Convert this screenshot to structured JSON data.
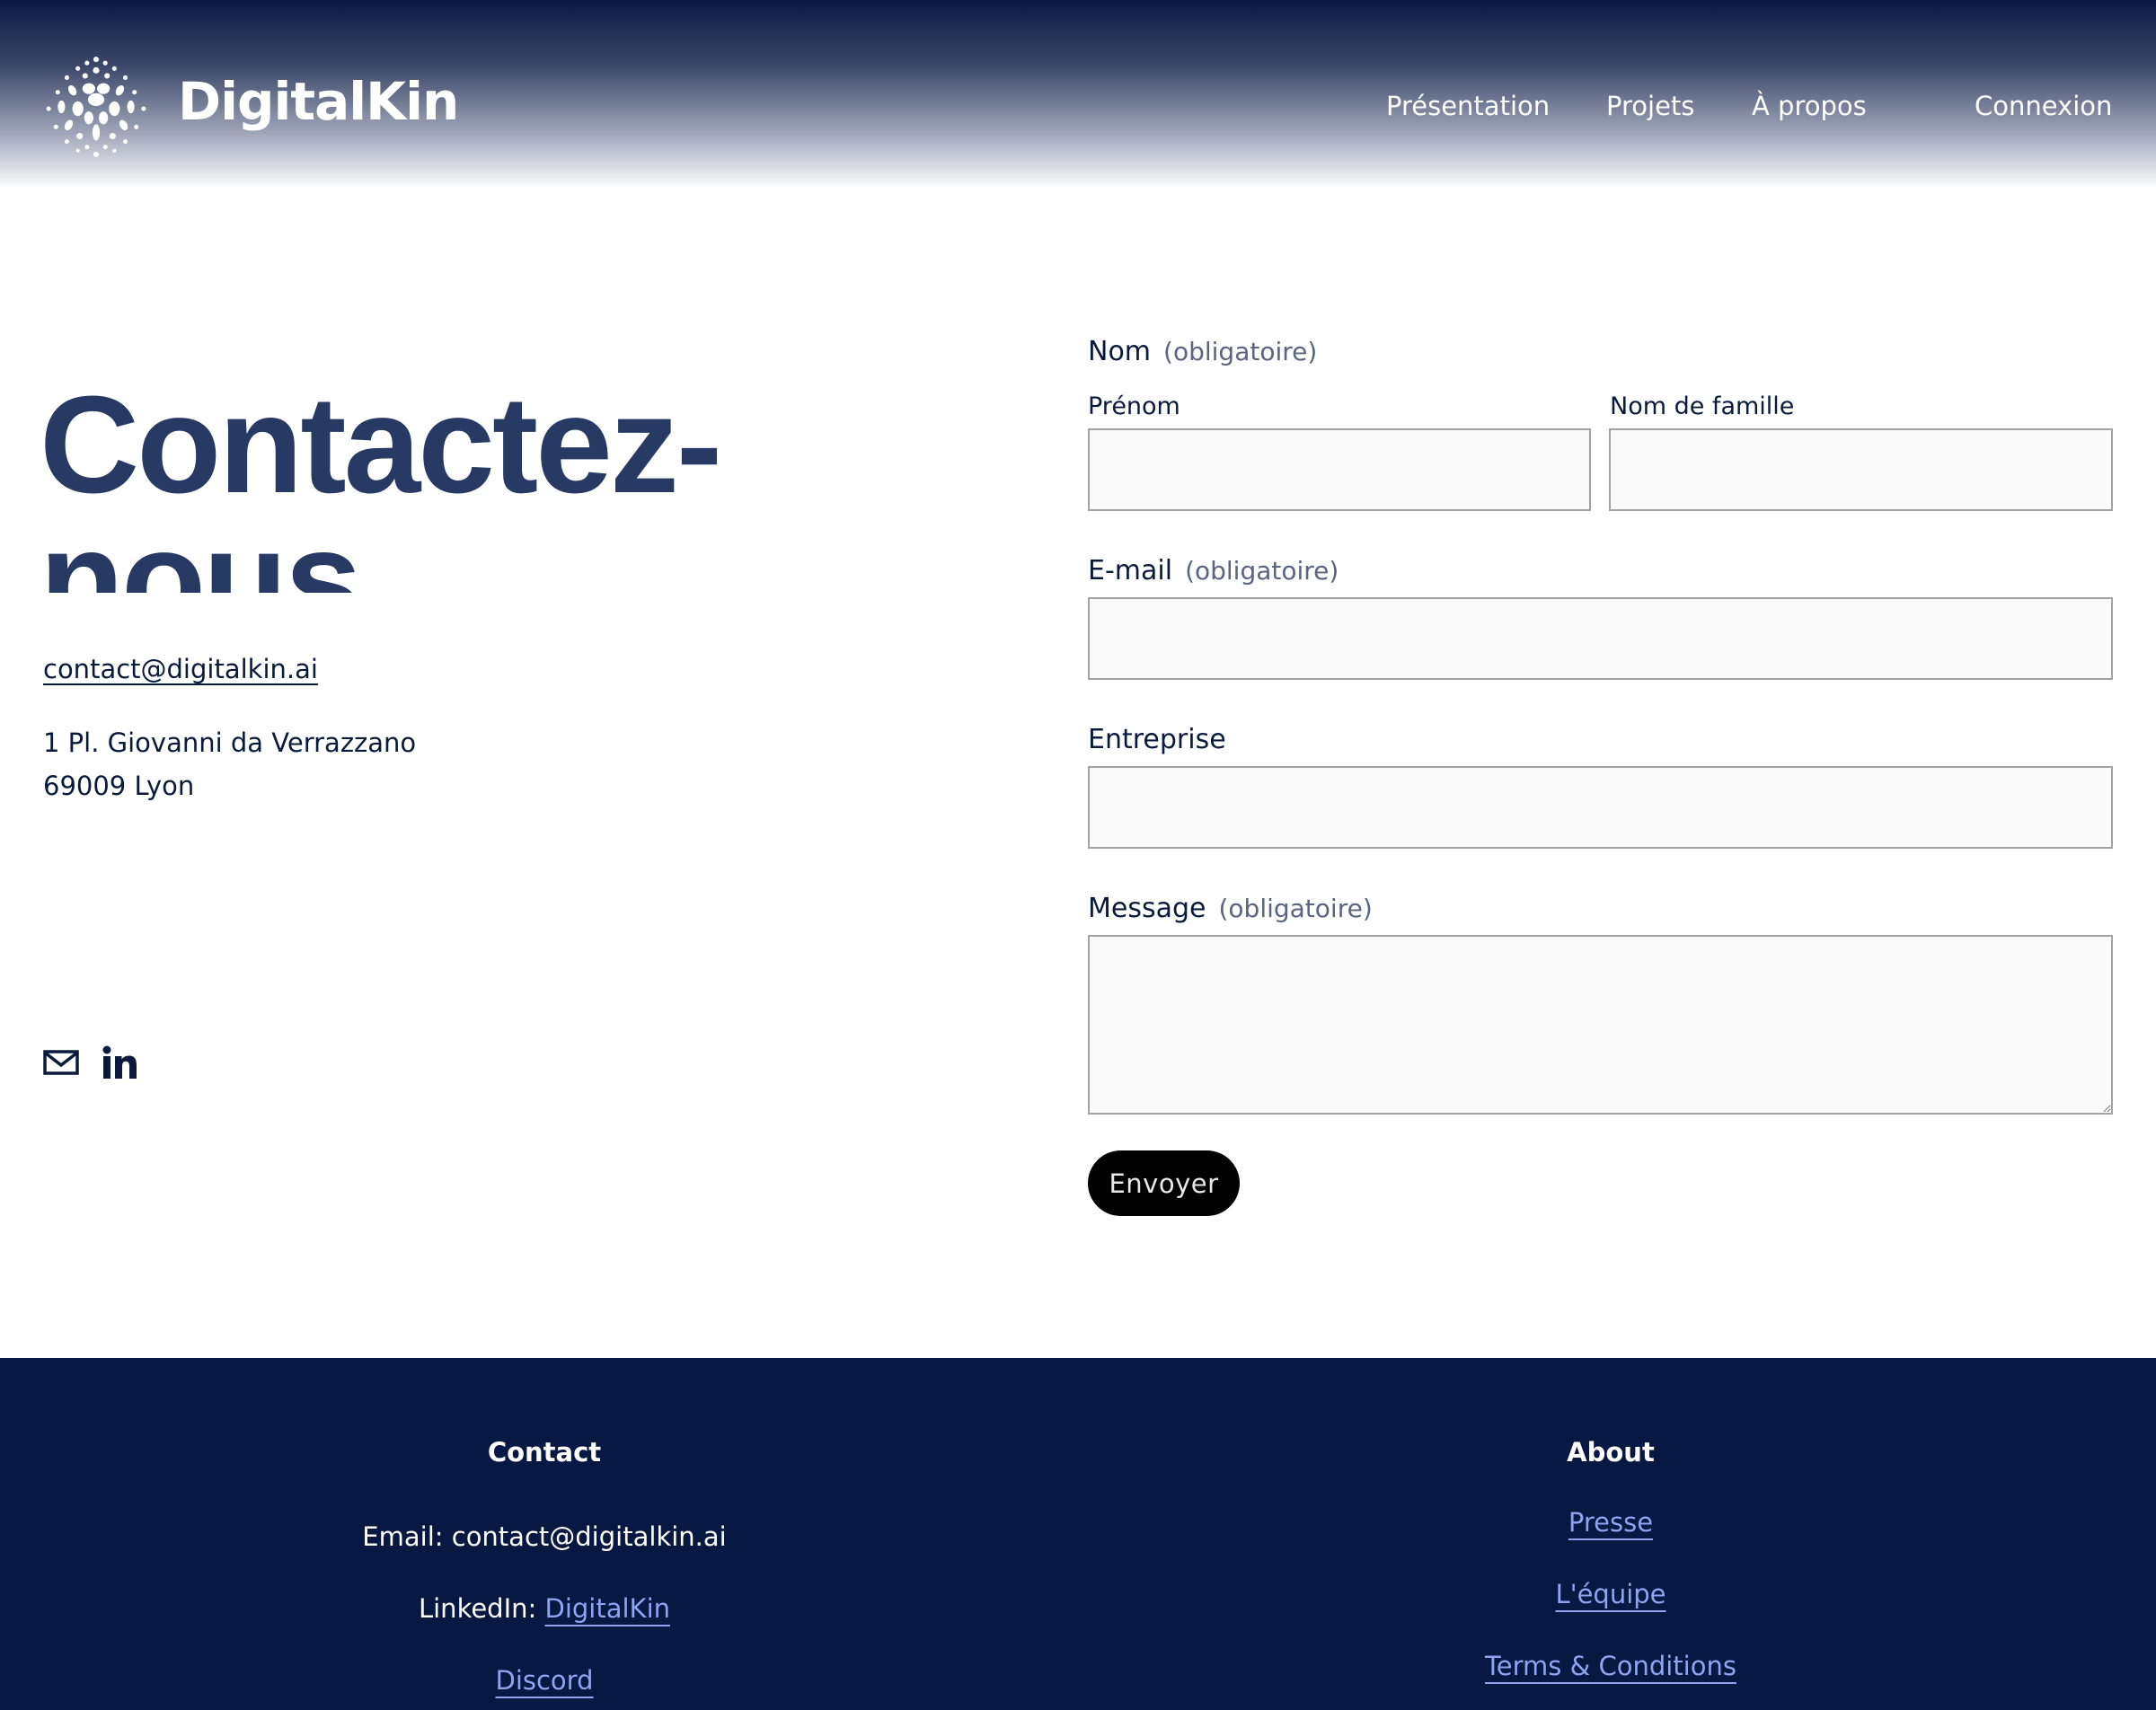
{
  "brand": {
    "name": "DigitalKin"
  },
  "nav": {
    "presentation": "Présentation",
    "projets": "Projets",
    "apropos": "À propos",
    "connexion": "Connexion"
  },
  "contact": {
    "title": "Contactez-nous",
    "email": "contact@digitalkin.ai",
    "address_line1": "1 Pl. Giovanni da Verrazzano",
    "address_line2": "69009 Lyon",
    "social_icons": [
      "mail-icon",
      "linkedin-icon"
    ]
  },
  "form": {
    "name_label": "Nom",
    "required_text": "(obligatoire)",
    "firstname_label": "Prénom",
    "lastname_label": "Nom de famille",
    "email_label": "E-mail",
    "company_label": "Entreprise",
    "message_label": "Message",
    "firstname_value": "",
    "lastname_value": "",
    "email_value": "",
    "company_value": "",
    "message_value": "",
    "submit_label": "Envoyer"
  },
  "footer": {
    "contact": {
      "heading": "Contact",
      "email_line": "Email: contact@digitalkin.ai",
      "linkedin_prefix": "LinkedIn: ",
      "linkedin_link": "DigitalKin",
      "discord_link": "Discord"
    },
    "about": {
      "heading": "About",
      "links": [
        "Presse",
        "L'équipe",
        "Terms & Conditions"
      ]
    }
  },
  "colors": {
    "header_top": "#0a1942",
    "title": "#273a64",
    "text": "#0a1a3c",
    "footer_bg": "#071842",
    "footer_link": "#8fa3f0",
    "button_bg": "#000000"
  }
}
